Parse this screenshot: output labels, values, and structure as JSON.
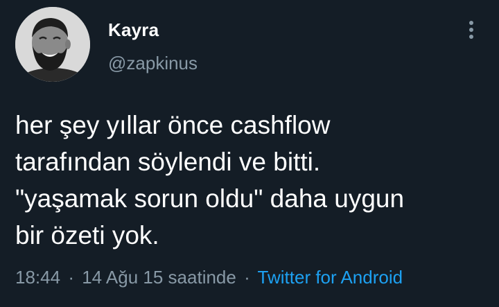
{
  "author": {
    "display_name": "Kayra",
    "handle": "@zapkinus"
  },
  "tweet": {
    "lines": [
      "her şey yıllar önce cashflow",
      "tarafından söylendi ve bitti.",
      "\"yaşamak sorun oldu\" daha uygun",
      "bir özeti yok."
    ]
  },
  "meta": {
    "time": "18:44",
    "date": "14 Ağu 15 saatinde",
    "separator": "·",
    "source": "Twitter for Android"
  },
  "colors": {
    "background": "#141d26",
    "secondary_text": "#8899a6",
    "link": "#1da1f2"
  },
  "icons": {
    "more": "more-vertical-icon"
  }
}
